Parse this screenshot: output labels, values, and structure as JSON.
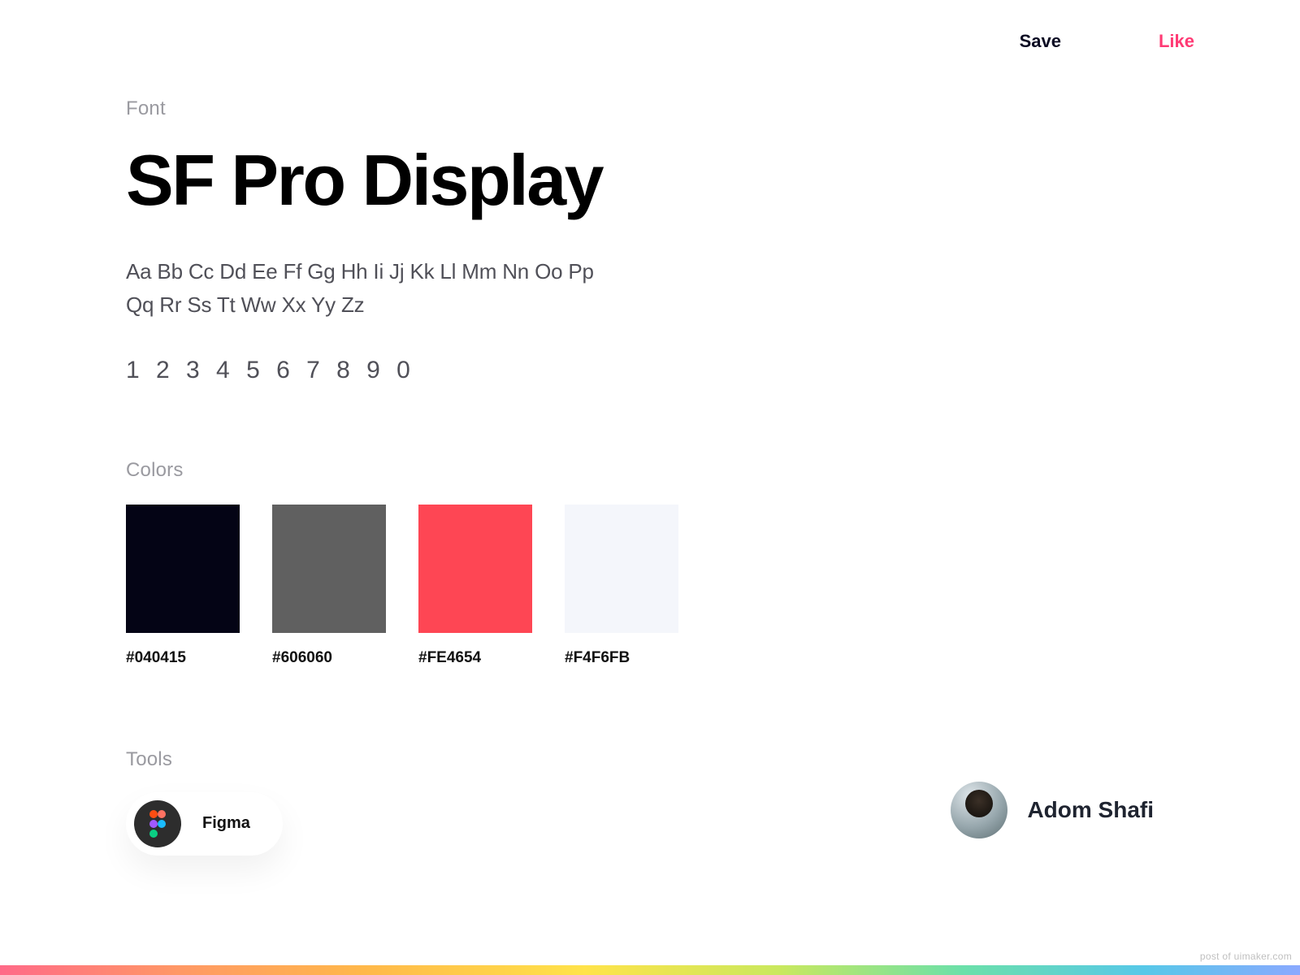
{
  "topbar": {
    "save_label": "Save",
    "like_label": "Like"
  },
  "font": {
    "section_label": "Font",
    "name": "SF Pro Display",
    "alphabet_line1": "Aa Bb Cc Dd Ee Ff Gg Hh Ii Jj Kk Ll Mm Nn Oo Pp",
    "alphabet_line2": "Qq Rr Ss Tt Ww Xx Yy Zz",
    "digits": "1 2 3 4 5 6 7 8 9 0"
  },
  "colors": {
    "section_label": "Colors",
    "swatches": [
      {
        "hex": "#040415"
      },
      {
        "hex": "#606060"
      },
      {
        "hex": "#FE4654"
      },
      {
        "hex": "#F4F6FB"
      }
    ]
  },
  "tools": {
    "section_label": "Tools",
    "items": [
      {
        "name": "Figma",
        "icon": "figma-icon"
      }
    ]
  },
  "author": {
    "name": "Adom Shafi"
  },
  "watermark": "post of uimaker.com"
}
